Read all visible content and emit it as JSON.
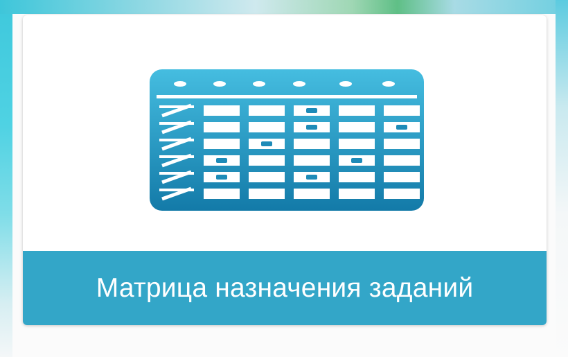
{
  "tile": {
    "title": "Матрица назначения заданий",
    "icon": "task-matrix-table-icon",
    "footer_color": "#33a6c8",
    "icon_color_top": "#3fb6d8",
    "icon_color_bottom": "#1678a6"
  }
}
